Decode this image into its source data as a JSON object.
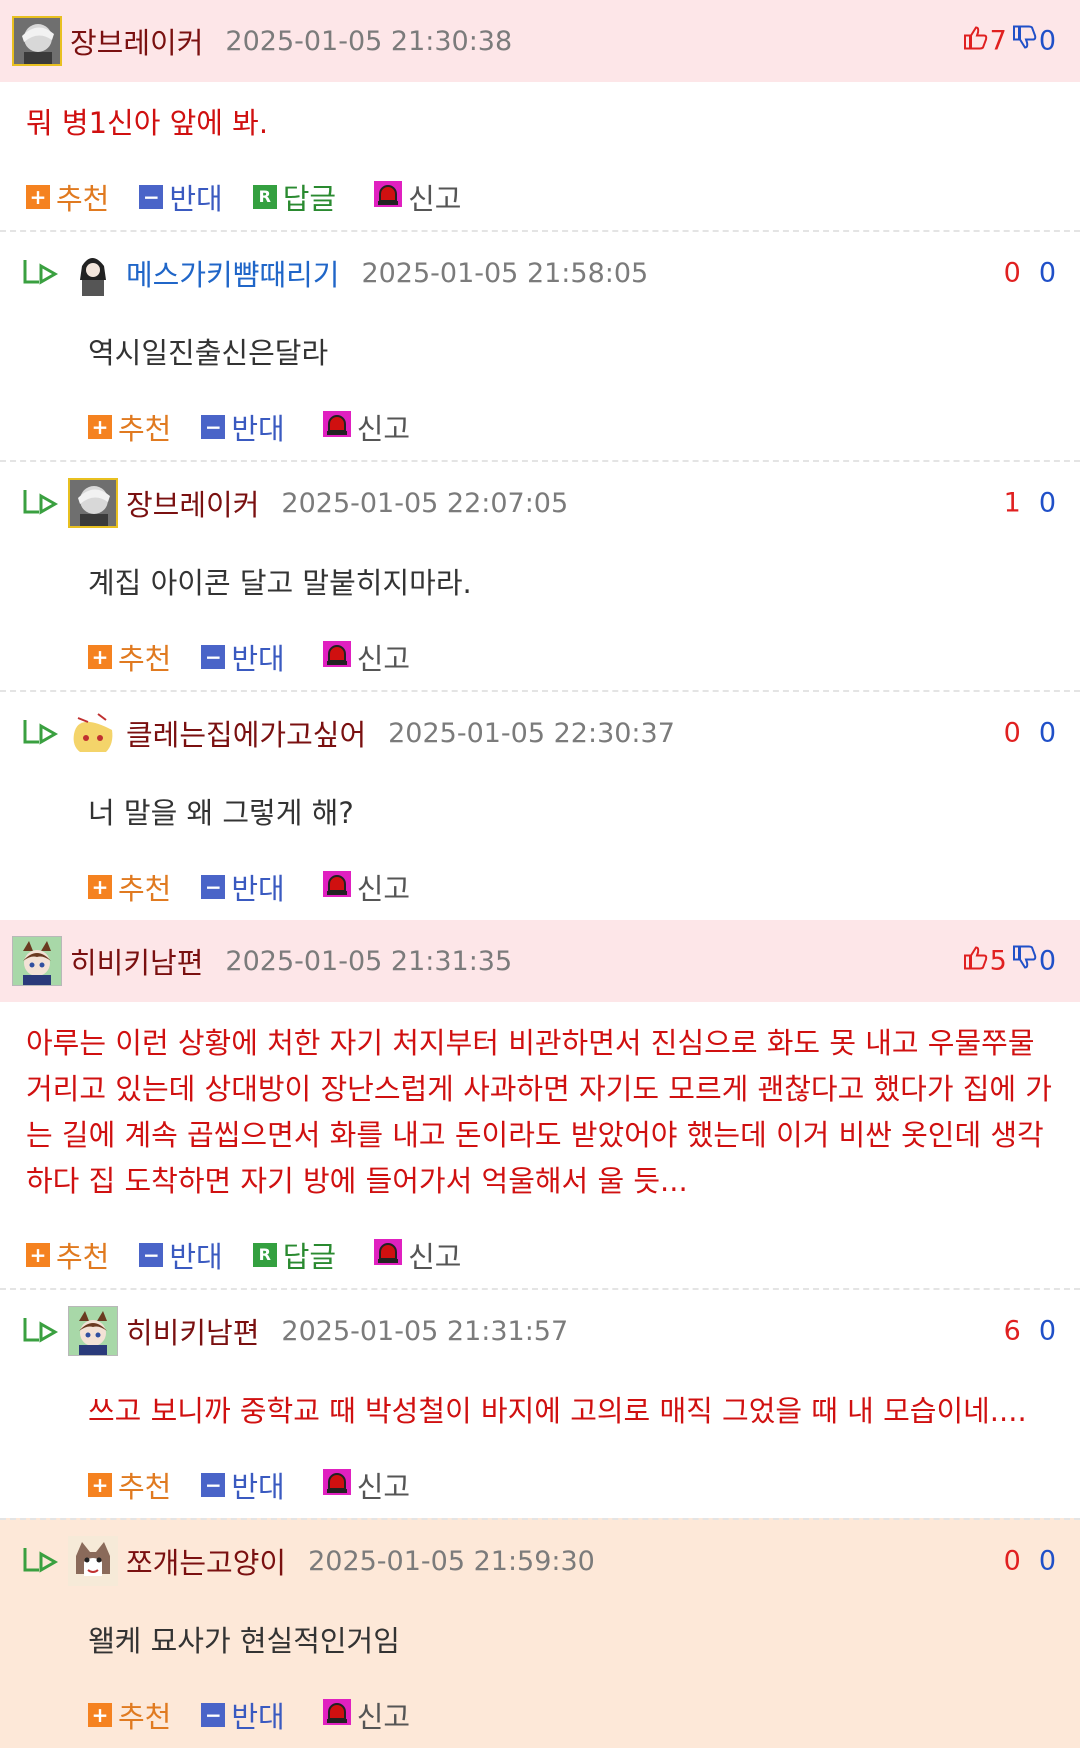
{
  "actions": {
    "recommend": "추천",
    "oppose": "반대",
    "reply": "답글",
    "report": "신고"
  },
  "colors": {
    "highlight_bg": "#fde6e8",
    "reply_highlight_bg": "#fde8d8",
    "up": "#e02020",
    "down": "#2050c8",
    "red_text": "#d01010"
  },
  "comments": [
    {
      "nick": "장브레이커",
      "date": "2025-01-05 21:30:38",
      "up": "7",
      "down": "0",
      "text": "뭐 병1신아 앞에 봐."
    },
    {
      "nick": "메스가키뺨때리기",
      "date": "2025-01-05 21:58:05",
      "up": "0",
      "down": "0",
      "text": "역시일진출신은달라"
    },
    {
      "nick": "장브레이커",
      "date": "2025-01-05 22:07:05",
      "up": "1",
      "down": "0",
      "text": "계집 아이콘 달고 말붙히지마라."
    },
    {
      "nick": "클레는집에가고싶어",
      "date": "2025-01-05 22:30:37",
      "up": "0",
      "down": "0",
      "text": "너 말을 왜 그렇게 해?"
    },
    {
      "nick": "히비키남편",
      "date": "2025-01-05 21:31:35",
      "up": "5",
      "down": "0",
      "text": "아루는 이런 상황에 처한 자기 처지부터 비관하면서 진심으로 화도 못 내고 우물쭈물 거리고 있는데 상대방이 장난스럽게 사과하면 자기도 모르게 괜찮다고 했다가 집에 가는 길에 계속 곱씹으면서 화를 내고 돈이라도 받았어야 했는데 이거 비싼 옷인데 생각하다 집 도착하면 자기 방에 들어가서 억울해서 울 듯..."
    },
    {
      "nick": "히비키남편",
      "date": "2025-01-05 21:31:57",
      "up": "6",
      "down": "0",
      "text": "쓰고 보니까 중학교 때 박성철이 바지에 고의로 매직 그었을 때 내 모습이네...."
    },
    {
      "nick": "쪼개는고양이",
      "date": "2025-01-05 21:59:30",
      "up": "0",
      "down": "0",
      "text": "왤케 묘사가 현실적인거임"
    }
  ]
}
